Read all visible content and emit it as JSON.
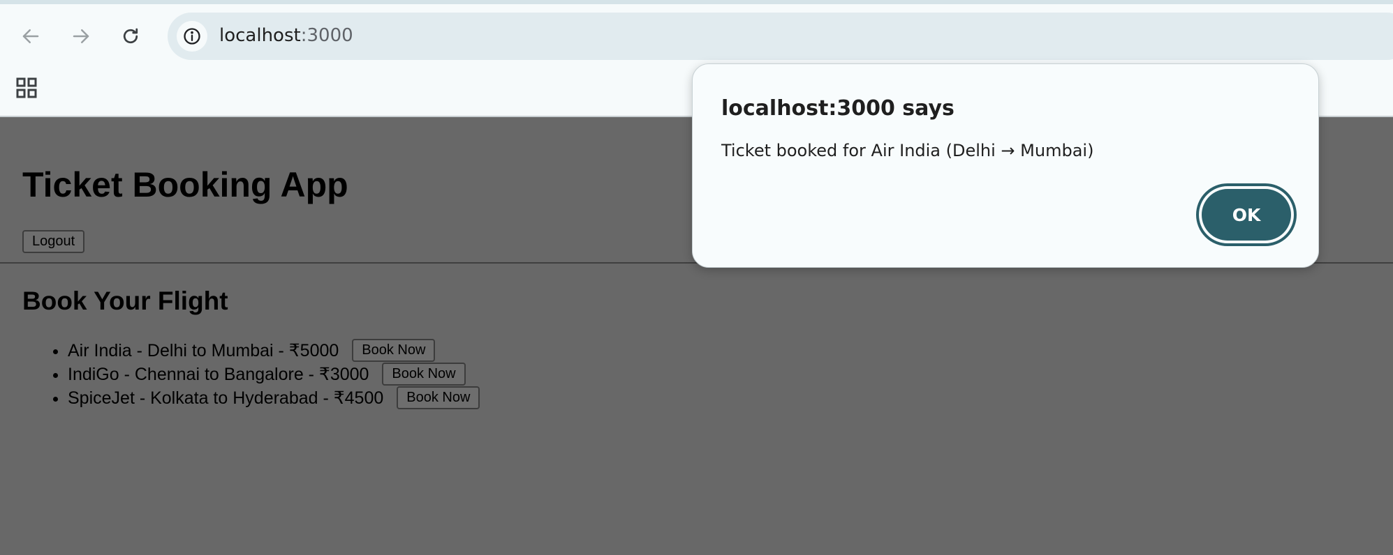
{
  "browser": {
    "url_host": "localhost",
    "url_port": ":3000",
    "icons": {
      "back": "arrow-left-icon",
      "forward": "arrow-right-icon",
      "reload": "reload-icon",
      "site_info": "info-icon",
      "apps": "apps-grid-icon"
    }
  },
  "page": {
    "title": "Ticket Booking App",
    "logout_label": "Logout",
    "section_title": "Book Your Flight",
    "flights": [
      {
        "text": "Air India - Delhi to Mumbai - ₹5000",
        "button": "Book Now"
      },
      {
        "text": "IndiGo - Chennai to Bangalore - ₹3000",
        "button": "Book Now"
      },
      {
        "text": "SpiceJet - Kolkata to Hyderabad - ₹4500",
        "button": "Book Now"
      }
    ]
  },
  "dialog": {
    "title": "localhost:3000 says",
    "message": "Ticket booked for Air India (Delhi → Mumbai)",
    "ok_label": "OK",
    "accent_color": "#2b5f6a"
  }
}
